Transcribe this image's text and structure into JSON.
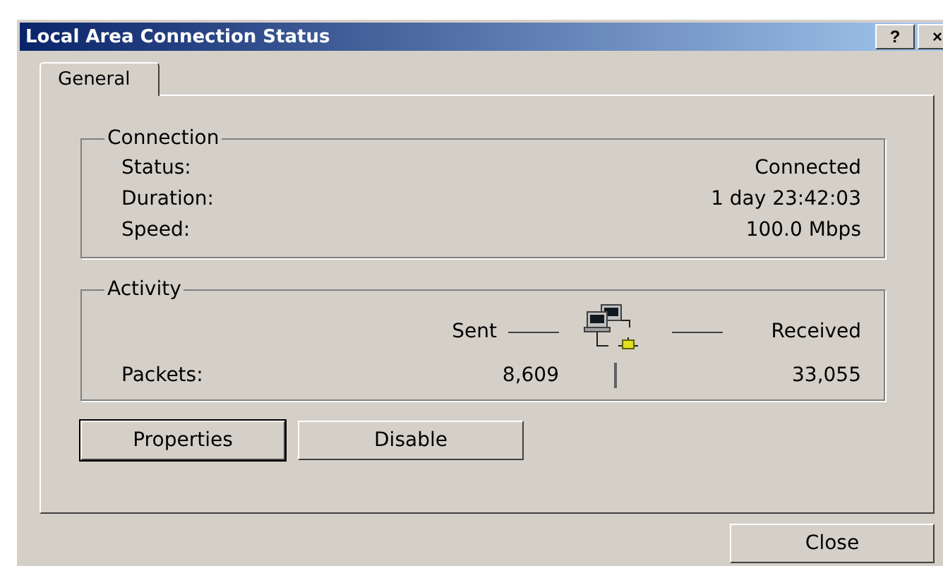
{
  "window": {
    "title": "Local Area Connection Status",
    "title_buttons": [
      "?",
      "×"
    ]
  },
  "tabs": [
    {
      "label": "General",
      "selected": true
    }
  ],
  "connection": {
    "title": "Connection",
    "rows": [
      {
        "label": "Status:",
        "value": "Connected"
      },
      {
        "label": "Duration:",
        "value": "1 day 23:42:03"
      },
      {
        "label": "Speed:",
        "value": "100.0 Mbps"
      }
    ]
  },
  "activity": {
    "title": "Activity",
    "sent_label": "Sent",
    "received_label": "Received",
    "packets_label": "Packets:",
    "sent": "8,609",
    "received": "33,055"
  },
  "buttons": [
    {
      "label": "Properties",
      "default": true
    },
    {
      "label": "Disable",
      "default": false
    }
  ],
  "footer_buttons": [
    {
      "label": "Close",
      "default": false
    }
  ]
}
